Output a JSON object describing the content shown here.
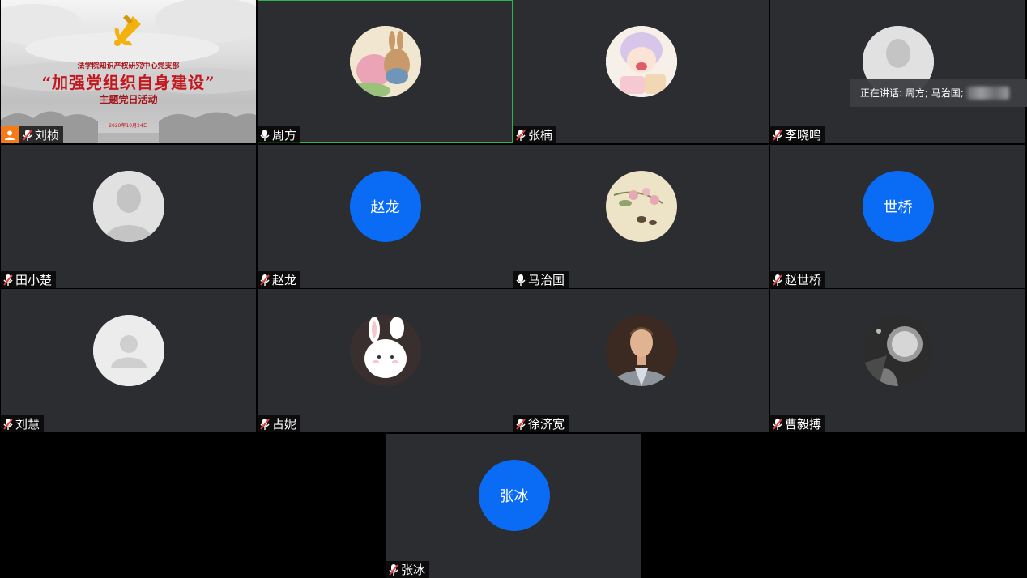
{
  "shared_slide": {
    "org": "法学院知识产权研究中心党支部",
    "title": "“加强党组织自身建设”",
    "subtitle": "主题党日活动",
    "date": "2020年10月24日"
  },
  "speaking_indicator": {
    "label": "正在讲话: 周方; 马治国;"
  },
  "participants": [
    {
      "name": "刘桢",
      "mic": "muted",
      "host": true
    },
    {
      "name": "周方",
      "mic": "on"
    },
    {
      "name": "张楠",
      "mic": "muted"
    },
    {
      "name": "李晓鸣",
      "mic": "muted"
    },
    {
      "name": "田小楚",
      "mic": "muted"
    },
    {
      "name": "赵龙",
      "mic": "muted",
      "avatar_text": "赵龙"
    },
    {
      "name": "马治国",
      "mic": "on"
    },
    {
      "name": "赵世桥",
      "mic": "muted",
      "avatar_text": "世桥"
    },
    {
      "name": "刘慧",
      "mic": "muted"
    },
    {
      "name": "占妮",
      "mic": "muted"
    },
    {
      "name": "徐济宽",
      "mic": "muted"
    },
    {
      "name": "曹毅搏",
      "mic": "muted"
    },
    {
      "name": "张冰",
      "mic": "muted",
      "avatar_text": "张冰"
    }
  ],
  "colors": {
    "tile_bg": "#2b2d30",
    "text_avatar": "#0a6cf5",
    "active_border": "#2fb34a",
    "host_badge": "#f47b16",
    "muted_mic": "#e23b3b"
  }
}
